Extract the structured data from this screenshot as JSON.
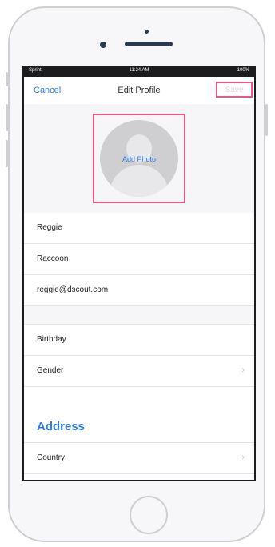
{
  "status_bar": {
    "carrier": "Sprint",
    "time": "11:24 AM",
    "battery": "100%"
  },
  "nav": {
    "cancel_label": "Cancel",
    "title": "Edit Profile",
    "save_label": "Save"
  },
  "avatar": {
    "add_photo_label": "Add Photo"
  },
  "fields": {
    "first_name": "Reggie",
    "last_name": "Raccoon",
    "email": "reggie@dscout.com",
    "birthday_label": "Birthday",
    "gender_label": "Gender"
  },
  "address": {
    "heading": "Address",
    "country_label": "Country"
  },
  "colors": {
    "accent": "#2f7de1",
    "highlight": "#e7588a"
  }
}
